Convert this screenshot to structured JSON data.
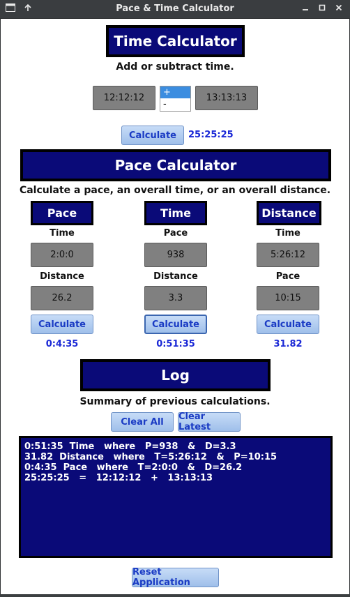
{
  "window": {
    "title": "Pace & Time Calculator"
  },
  "time_calc": {
    "heading": "Time Calculator",
    "subtitle": "Add or subtract time.",
    "time1": "12:12:12",
    "time2": "13:13:13",
    "operators": [
      "+",
      "-"
    ],
    "selected_operator": "+",
    "calculate_label": "Calculate",
    "result": "25:25:25"
  },
  "pace_calc": {
    "heading": "Pace Calculator",
    "subtitle": "Calculate a pace, an overall time, or an overall distance.",
    "columns": [
      {
        "heading": "Pace",
        "field1_label": "Time",
        "field1_value": "2:0:0",
        "field2_label": "Distance",
        "field2_value": "26.2",
        "calculate_label": "Calculate",
        "result": "0:4:35"
      },
      {
        "heading": "Time",
        "field1_label": "Pace",
        "field1_value": "938",
        "field2_label": "Distance",
        "field2_value": "3.3",
        "calculate_label": "Calculate",
        "result": "0:51:35"
      },
      {
        "heading": "Distance",
        "field1_label": "Time",
        "field1_value": "5:26:12",
        "field2_label": "Pace",
        "field2_value": "10:15",
        "calculate_label": "Calculate",
        "result": "31.82"
      }
    ]
  },
  "log": {
    "heading": "Log",
    "subtitle": "Summary of previous calculations.",
    "clear_all_label": "Clear All",
    "clear_latest_label": "Clear Latest",
    "entries": [
      "0:51:35  Time   where   P=938   &   D=3.3",
      "31.82  Distance   where   T=5:26:12   &   P=10:15",
      "0:4:35  Pace   where   T=2:0:0   &   D=26.2",
      "25:25:25   =   12:12:12   +   13:13:13"
    ]
  },
  "reset_label": "Reset Application"
}
